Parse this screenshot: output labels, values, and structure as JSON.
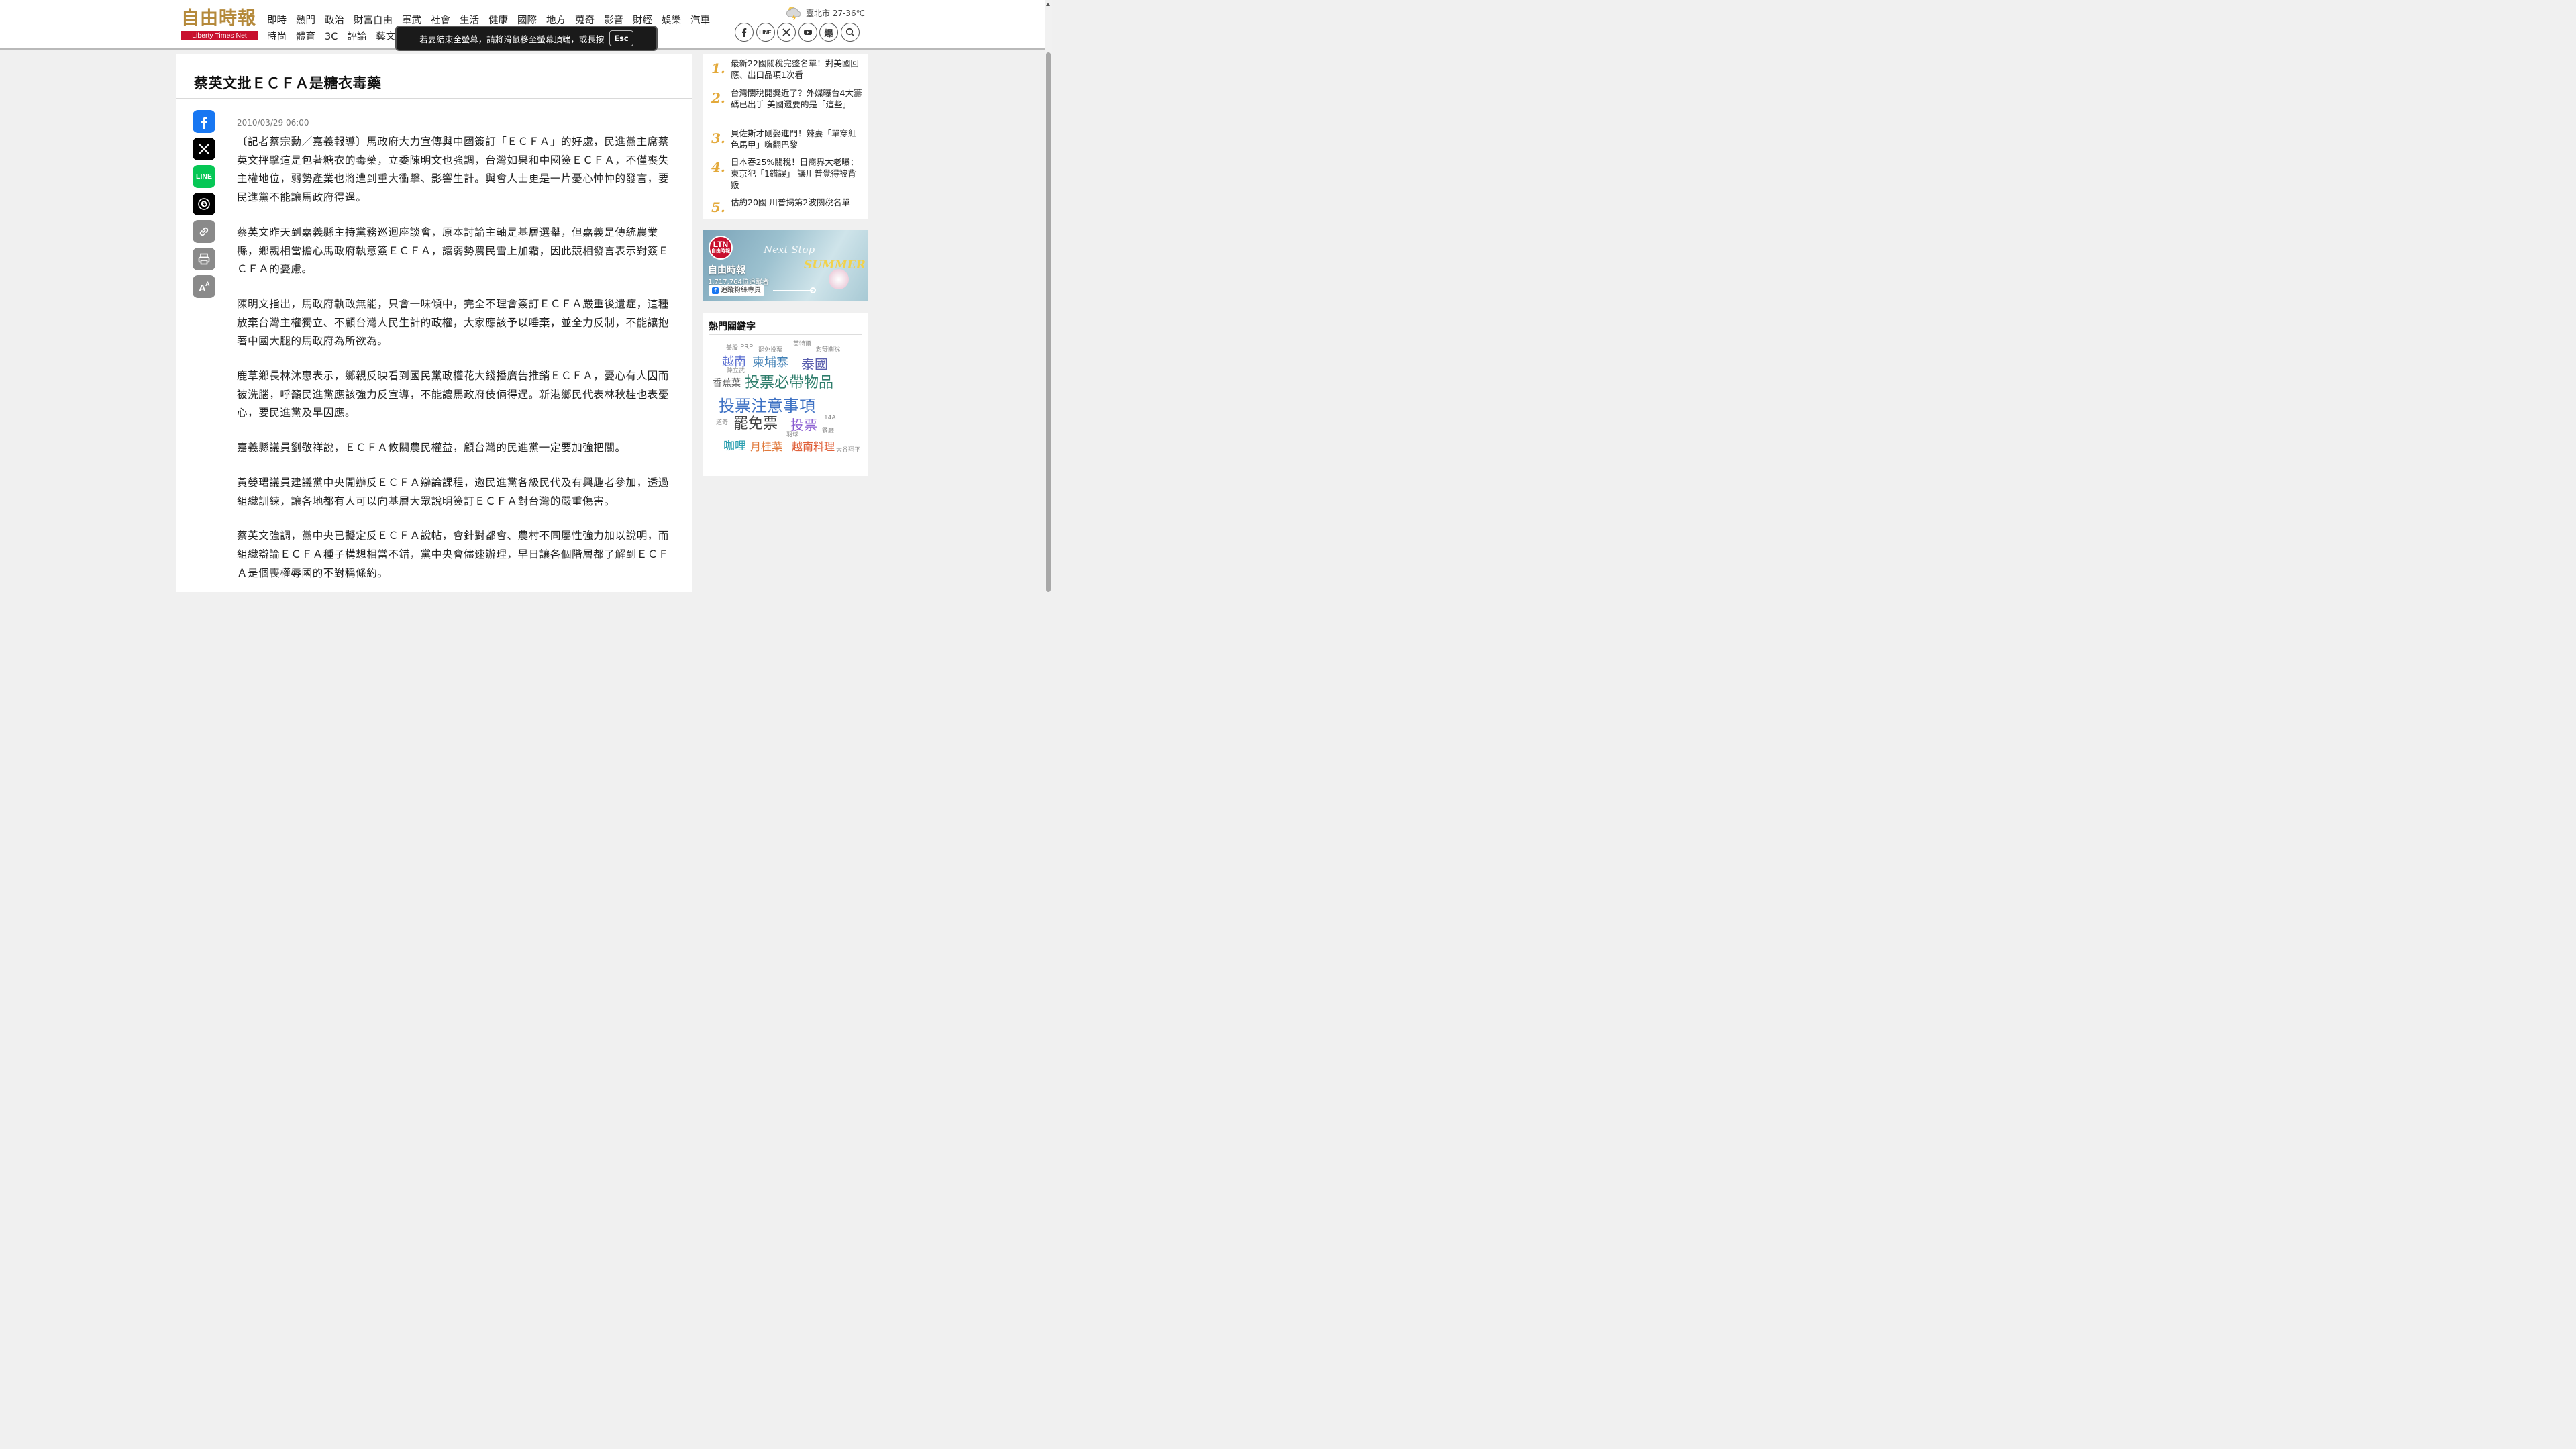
{
  "logo": {
    "text": "自由時報",
    "subtext": "Liberty Times Net"
  },
  "nav": {
    "row1": [
      "即時",
      "熱門",
      "政治",
      "財富自由",
      "軍武",
      "社會",
      "生活",
      "健康",
      "國際",
      "地方",
      "蒐奇",
      "影音",
      "財經",
      "娛樂",
      "汽車"
    ],
    "row2": [
      "時尚",
      "體育",
      "3C",
      "評論",
      "藝文"
    ],
    "new_badge": "NEW"
  },
  "weather": {
    "icon": "cloud-thunder-icon",
    "text": "臺北市 27-36℃"
  },
  "social": {
    "line_label": "LINE",
    "bao_label": "爆"
  },
  "fullscreen_notice": {
    "text": "若要結束全螢幕，請將滑鼠移至螢幕頂端，或長按",
    "key": "Esc"
  },
  "article": {
    "title": "蔡英文批ＥＣＦＡ是糖衣毒藥",
    "date": "2010/03/29 06:00",
    "paragraphs": [
      "〔記者蔡宗勳／嘉義報導〕馬政府大力宣傳與中國簽訂「ＥＣＦＡ」的好處，民進黨主席蔡英文抨擊這是包著糖衣的毒藥，立委陳明文也強調，台灣如果和中國簽ＥＣＦＡ，不僅喪失主權地位，弱勢產業也將遭到重大衝擊、影響生計。與會人士更是一片憂心忡忡的發言，要民進黨不能讓馬政府得逞。",
      "蔡英文昨天到嘉義縣主持黨務巡迴座談會，原本討論主軸是基層選舉，但嘉義是傳統農業縣，鄉親相當擔心馬政府執意簽ＥＣＦＡ，讓弱勢農民雪上加霜，因此競相發言表示對簽ＥＣＦＡ的憂慮。",
      "陳明文指出，馬政府執政無能，只會一味傾中，完全不理會簽訂ＥＣＦＡ嚴重後遺症，這種放棄台灣主權獨立、不顧台灣人民生計的政權，大家應該予以唾棄，並全力反制，不能讓抱著中國大腿的馬政府為所欲為。",
      "鹿草鄉長林沐惠表示，鄉親反映看到國民黨政權花大錢播廣告推銷ＥＣＦＡ，憂心有人因而被洗腦，呼籲民進黨應該強力反宣導，不能讓馬政府伎倆得逞。新港鄉民代表林秋桂也表憂心，要民進黨及早因應。",
      "嘉義縣議員劉敬祥說，ＥＣＦＡ攸關農民權益，顧台灣的民進黨一定要加強把關。",
      "黃嫈珺議員建議黨中央開辦反ＥＣＦＡ辯論課程，邀民進黨各級民代及有興趣者參加，透過組織訓練，讓各地都有人可以向基層大眾說明簽訂ＥＣＦＡ對台灣的嚴重傷害。",
      "蔡英文強調，黨中央已擬定反ＥＣＦＡ說帖，會針對都會、農村不同屬性強力加以說明，而組織辯論ＥＣＦＡ種子構想相當不錯，黨中央會儘速辦理，早日讓各個階層都了解到ＥＣＦＡ是個喪權辱國的不對稱條約。"
    ]
  },
  "ranking": [
    {
      "num": "1.",
      "text": "最新22國關稅完整名單！對美國回應、出口品項1次看"
    },
    {
      "num": "2.",
      "text": "台灣關稅開獎近了？外媒曝台4大籌碼已出手 美國還要的是「這些」"
    },
    {
      "num": "3.",
      "text": "貝佐斯才剛娶進門！辣妻「單穿紅色馬甲」嗨翻巴黎"
    },
    {
      "num": "4.",
      "text": "日本吞25%關稅！日商界大老曝：東京犯「1錯誤」 讓川普覺得被背叛"
    },
    {
      "num": "5.",
      "text": "估約20國 川普揭第2波關稅名單"
    }
  ],
  "fb_banner": {
    "badge": "LTN",
    "badge_sub": "自由時報",
    "page_name": "自由時報",
    "followers": "1,717,764位追蹤者",
    "follow_label": "追蹤粉絲專頁",
    "slogan": "Next Stop",
    "slogan2": "SUMMER"
  },
  "keywords": {
    "title": "熱門關鍵字",
    "words": [
      {
        "text": "美股",
        "color": "#888888"
      },
      {
        "text": "PRP",
        "color": "#888888"
      },
      {
        "text": "罷免投票",
        "color": "#888888"
      },
      {
        "text": "英特爾",
        "color": "#888888"
      },
      {
        "text": "對等關稅",
        "color": "#888888"
      },
      {
        "text": "越南",
        "color": "#5b6fd1"
      },
      {
        "text": "陳立武",
        "color": "#888888"
      },
      {
        "text": "柬埔寨",
        "color": "#3f7fb5"
      },
      {
        "text": "泰國",
        "color": "#5a5fae"
      },
      {
        "text": "香蕉葉",
        "color": "#666666"
      },
      {
        "text": "投票必帶物品",
        "color": "#2e7d6b"
      },
      {
        "text": "投票注意事項",
        "color": "#3f72c4"
      },
      {
        "text": "道奇",
        "color": "#888888"
      },
      {
        "text": "罷免票",
        "color": "#444444"
      },
      {
        "text": "投票",
        "color": "#8a5cd1"
      },
      {
        "text": "14A",
        "color": "#888888"
      },
      {
        "text": "羽球",
        "color": "#888888"
      },
      {
        "text": "餐廳",
        "color": "#888888"
      },
      {
        "text": "咖哩",
        "color": "#2a9fb0"
      },
      {
        "text": "月桂葉",
        "color": "#e0783a"
      },
      {
        "text": "越南料理",
        "color": "#e0603a"
      },
      {
        "text": "大谷翔平",
        "color": "#888888"
      }
    ]
  }
}
